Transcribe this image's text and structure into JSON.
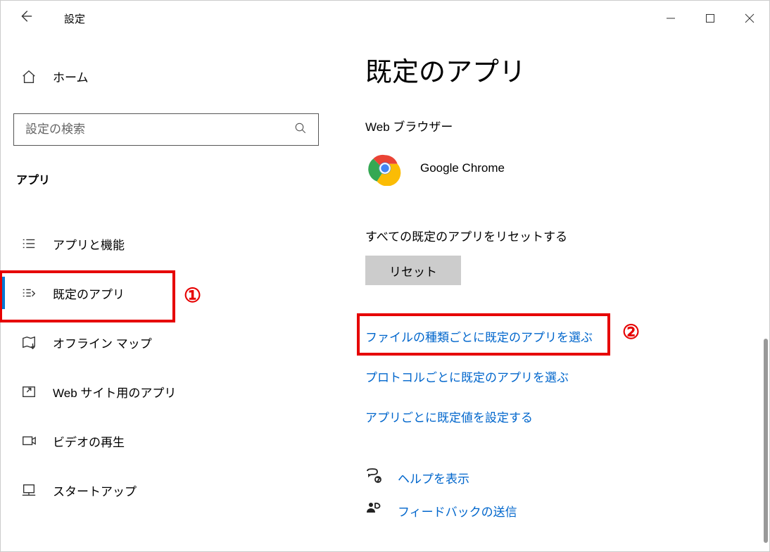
{
  "window": {
    "title": "設定"
  },
  "sidebar": {
    "home": "ホーム",
    "search_placeholder": "設定の検索",
    "category": "アプリ",
    "items": [
      {
        "label": "アプリと機能"
      },
      {
        "label": "既定のアプリ"
      },
      {
        "label": "オフライン マップ"
      },
      {
        "label": "Web サイト用のアプリ"
      },
      {
        "label": "ビデオの再生"
      },
      {
        "label": "スタートアップ"
      }
    ]
  },
  "content": {
    "title": "既定のアプリ",
    "browser_label": "Web ブラウザー",
    "default_browser": "Google Chrome",
    "reset_label": "すべての既定のアプリをリセットする",
    "reset_button": "リセット",
    "links": {
      "by_file_type": "ファイルの種類ごとに既定のアプリを選ぶ",
      "by_protocol": "プロトコルごとに既定のアプリを選ぶ",
      "by_app": "アプリごとに既定値を設定する"
    },
    "help": "ヘルプを表示",
    "feedback": "フィードバックの送信"
  },
  "annotations": {
    "one": "①",
    "two": "②"
  }
}
